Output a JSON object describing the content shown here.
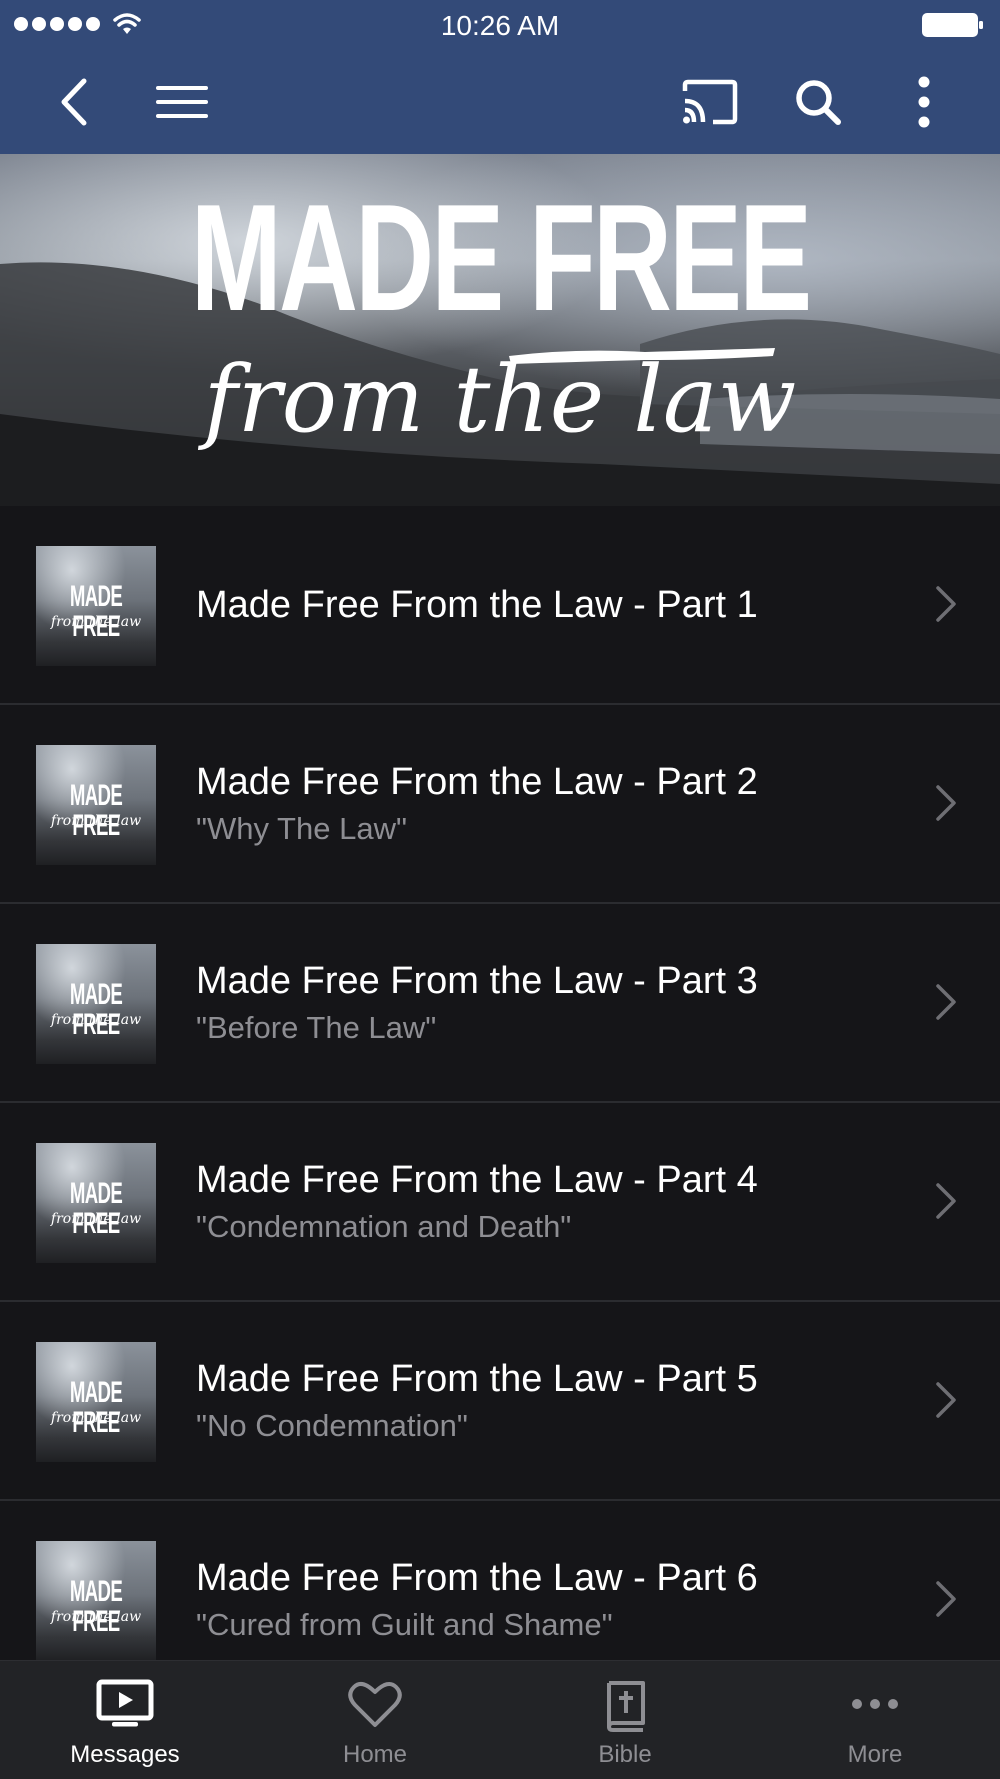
{
  "status_bar": {
    "time": "10:26 AM"
  },
  "nav": {
    "back_icon": "chevron-left-icon",
    "menu_icon": "hamburger-icon",
    "cast_icon": "cast-icon",
    "search_icon": "search-icon",
    "more_icon": "vertical-ellipsis-icon"
  },
  "hero": {
    "title": "MADE FREE",
    "subtitle": "from the law"
  },
  "series": [
    {
      "title": "Made Free From the Law - Part 1",
      "subtitle": ""
    },
    {
      "title": "Made Free From the Law - Part 2",
      "subtitle": "\"Why The Law\""
    },
    {
      "title": "Made Free From the Law - Part 3",
      "subtitle": "\"Before The Law\""
    },
    {
      "title": "Made Free From the Law - Part 4",
      "subtitle": "\"Condemnation and Death\""
    },
    {
      "title": "Made Free From the Law - Part 5",
      "subtitle": "\"No Condemnation\""
    },
    {
      "title": "Made Free From the Law - Part 6",
      "subtitle": "\"Cured from Guilt and Shame\""
    }
  ],
  "thumbnail": {
    "title": "MADE FREE",
    "subtitle": "from the law"
  },
  "tabs": [
    {
      "label": "Messages",
      "icon": "tv-play-icon",
      "active": true
    },
    {
      "label": "Home",
      "icon": "heart-icon",
      "active": false
    },
    {
      "label": "Bible",
      "icon": "bible-icon",
      "active": false
    },
    {
      "label": "More",
      "icon": "horizontal-ellipsis-icon",
      "active": false
    }
  ],
  "colors": {
    "header_bg": "#334a78",
    "list_bg": "#151518",
    "subtitle_text": "#8e8e93",
    "tab_active": "#ffffff",
    "tab_inactive": "#8e8e93"
  }
}
